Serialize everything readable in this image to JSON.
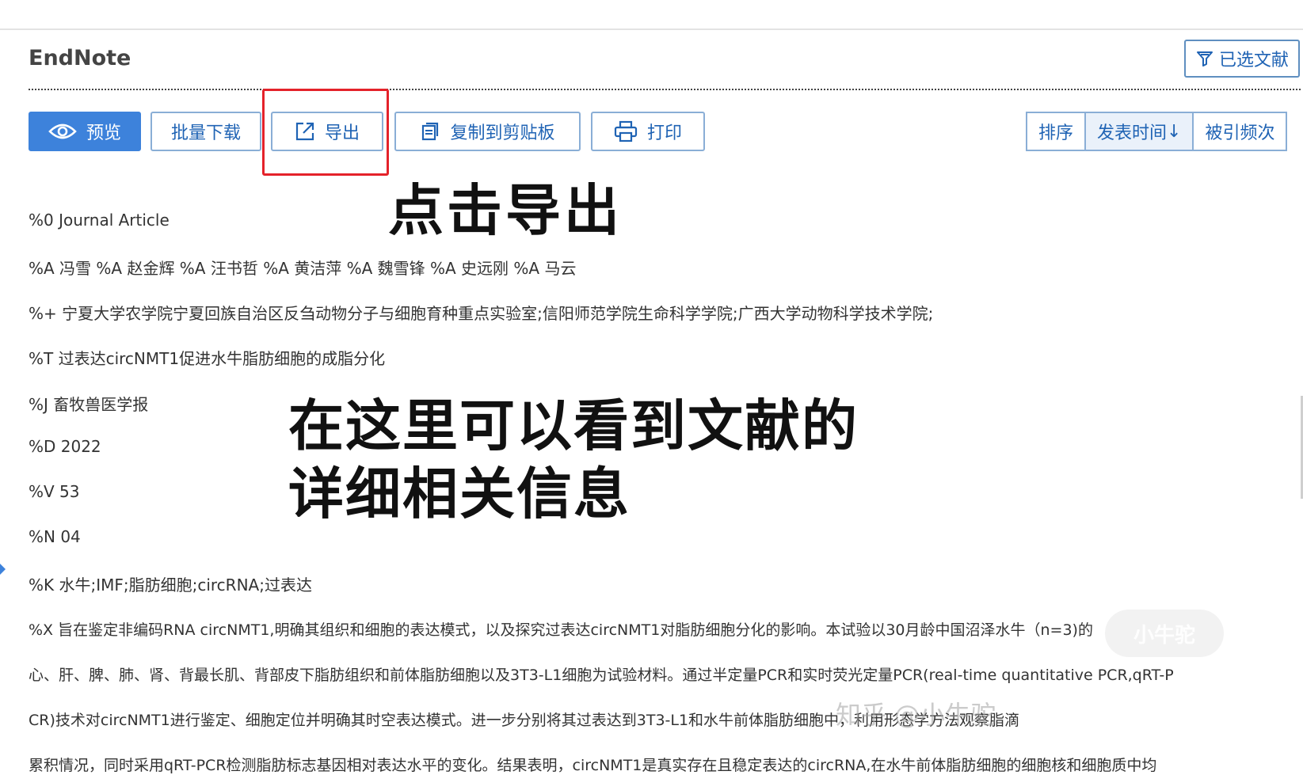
{
  "header": {
    "title": "EndNote",
    "selected_label": "已选文献"
  },
  "toolbar": {
    "preview": "预览",
    "batch_download": "批量下载",
    "export": "导出",
    "copy_clipboard": "复制到剪贴板",
    "print": "打印"
  },
  "sort": {
    "label": "排序",
    "publish_time": "发表时间",
    "publish_arrow": "↓",
    "citations": "被引频次"
  },
  "annotations": {
    "click_export": "点击导出",
    "detail_line1": "在这里可以看到文献的",
    "detail_line2": "详细相关信息"
  },
  "record": {
    "lines": [
      "%0 Journal Article",
      "%A 冯雪 %A 赵金辉 %A 汪书哲 %A 黄洁萍 %A 魏雪锋 %A 史远刚 %A 马云",
      "%+ 宁夏大学农学院宁夏回族自治区反刍动物分子与细胞育种重点实验室;信阳师范学院生命科学学院;广西大学动物科学技术学院;",
      "%T 过表达circNMT1促进水牛脂肪细胞的成脂分化",
      "%J 畜牧兽医学报",
      "%D 2022",
      "%V 53",
      "%N 04",
      "%K 水牛;IMF;脂肪细胞;circRNA;过表达",
      "%X 旨在鉴定非编码RNA circNMT1,明确其组织和细胞的表达模式，以及探究过表达circNMT1对脂肪细胞分化的影响。本试验以30月龄中国沼泽水牛（n=3)的",
      "心、肝、脾、肺、肾、背最长肌、背部皮下脂肪组织和前体脂肪细胞以及3T3-L1细胞为试验材料。通过半定量PCR和实时荧光定量PCR(real-time quantitative PCR,qRT-P",
      "CR)技术对circNMT1进行鉴定、细胞定位并明确其时空表达模式。进一步分别将其过表达到3T3-L1和水牛前体脂肪细胞中，利用形态学方法观察脂滴",
      "累积情况，同时采用qRT-PCR检测脂肪标志基因相对表达水平的变化。结果表明，circNMT1是真实存在且稳定表达的circRNA,在水牛前体脂肪细胞的细胞核和细胞质中均"
    ]
  },
  "watermark": {
    "text": "知乎 @小牛驼",
    "logo": "小牛驼"
  },
  "colors": {
    "accent": "#3d82db",
    "link": "#1f63b4",
    "highlight": "#e4222a"
  }
}
